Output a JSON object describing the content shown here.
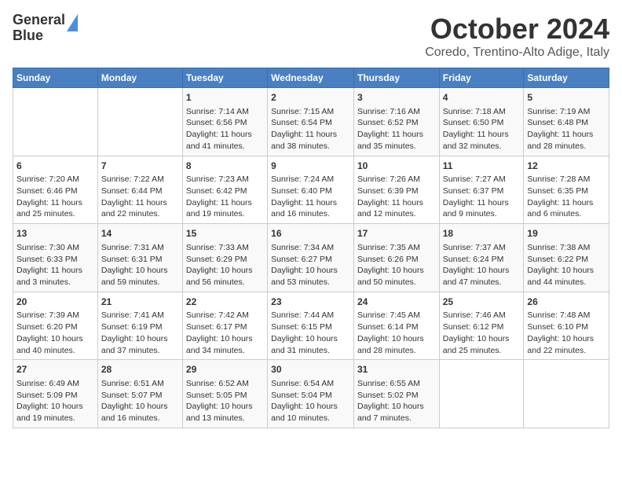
{
  "header": {
    "logo_line1": "General",
    "logo_line2": "Blue",
    "title": "October 2024",
    "subtitle": "Coredo, Trentino-Alto Adige, Italy"
  },
  "days_of_week": [
    "Sunday",
    "Monday",
    "Tuesday",
    "Wednesday",
    "Thursday",
    "Friday",
    "Saturday"
  ],
  "weeks": [
    [
      {
        "day": "",
        "content": ""
      },
      {
        "day": "",
        "content": ""
      },
      {
        "day": "1",
        "content": "Sunrise: 7:14 AM\nSunset: 6:56 PM\nDaylight: 11 hours and 41 minutes."
      },
      {
        "day": "2",
        "content": "Sunrise: 7:15 AM\nSunset: 6:54 PM\nDaylight: 11 hours and 38 minutes."
      },
      {
        "day": "3",
        "content": "Sunrise: 7:16 AM\nSunset: 6:52 PM\nDaylight: 11 hours and 35 minutes."
      },
      {
        "day": "4",
        "content": "Sunrise: 7:18 AM\nSunset: 6:50 PM\nDaylight: 11 hours and 32 minutes."
      },
      {
        "day": "5",
        "content": "Sunrise: 7:19 AM\nSunset: 6:48 PM\nDaylight: 11 hours and 28 minutes."
      }
    ],
    [
      {
        "day": "6",
        "content": "Sunrise: 7:20 AM\nSunset: 6:46 PM\nDaylight: 11 hours and 25 minutes."
      },
      {
        "day": "7",
        "content": "Sunrise: 7:22 AM\nSunset: 6:44 PM\nDaylight: 11 hours and 22 minutes."
      },
      {
        "day": "8",
        "content": "Sunrise: 7:23 AM\nSunset: 6:42 PM\nDaylight: 11 hours and 19 minutes."
      },
      {
        "day": "9",
        "content": "Sunrise: 7:24 AM\nSunset: 6:40 PM\nDaylight: 11 hours and 16 minutes."
      },
      {
        "day": "10",
        "content": "Sunrise: 7:26 AM\nSunset: 6:39 PM\nDaylight: 11 hours and 12 minutes."
      },
      {
        "day": "11",
        "content": "Sunrise: 7:27 AM\nSunset: 6:37 PM\nDaylight: 11 hours and 9 minutes."
      },
      {
        "day": "12",
        "content": "Sunrise: 7:28 AM\nSunset: 6:35 PM\nDaylight: 11 hours and 6 minutes."
      }
    ],
    [
      {
        "day": "13",
        "content": "Sunrise: 7:30 AM\nSunset: 6:33 PM\nDaylight: 11 hours and 3 minutes."
      },
      {
        "day": "14",
        "content": "Sunrise: 7:31 AM\nSunset: 6:31 PM\nDaylight: 10 hours and 59 minutes."
      },
      {
        "day": "15",
        "content": "Sunrise: 7:33 AM\nSunset: 6:29 PM\nDaylight: 10 hours and 56 minutes."
      },
      {
        "day": "16",
        "content": "Sunrise: 7:34 AM\nSunset: 6:27 PM\nDaylight: 10 hours and 53 minutes."
      },
      {
        "day": "17",
        "content": "Sunrise: 7:35 AM\nSunset: 6:26 PM\nDaylight: 10 hours and 50 minutes."
      },
      {
        "day": "18",
        "content": "Sunrise: 7:37 AM\nSunset: 6:24 PM\nDaylight: 10 hours and 47 minutes."
      },
      {
        "day": "19",
        "content": "Sunrise: 7:38 AM\nSunset: 6:22 PM\nDaylight: 10 hours and 44 minutes."
      }
    ],
    [
      {
        "day": "20",
        "content": "Sunrise: 7:39 AM\nSunset: 6:20 PM\nDaylight: 10 hours and 40 minutes."
      },
      {
        "day": "21",
        "content": "Sunrise: 7:41 AM\nSunset: 6:19 PM\nDaylight: 10 hours and 37 minutes."
      },
      {
        "day": "22",
        "content": "Sunrise: 7:42 AM\nSunset: 6:17 PM\nDaylight: 10 hours and 34 minutes."
      },
      {
        "day": "23",
        "content": "Sunrise: 7:44 AM\nSunset: 6:15 PM\nDaylight: 10 hours and 31 minutes."
      },
      {
        "day": "24",
        "content": "Sunrise: 7:45 AM\nSunset: 6:14 PM\nDaylight: 10 hours and 28 minutes."
      },
      {
        "day": "25",
        "content": "Sunrise: 7:46 AM\nSunset: 6:12 PM\nDaylight: 10 hours and 25 minutes."
      },
      {
        "day": "26",
        "content": "Sunrise: 7:48 AM\nSunset: 6:10 PM\nDaylight: 10 hours and 22 minutes."
      }
    ],
    [
      {
        "day": "27",
        "content": "Sunrise: 6:49 AM\nSunset: 5:09 PM\nDaylight: 10 hours and 19 minutes."
      },
      {
        "day": "28",
        "content": "Sunrise: 6:51 AM\nSunset: 5:07 PM\nDaylight: 10 hours and 16 minutes."
      },
      {
        "day": "29",
        "content": "Sunrise: 6:52 AM\nSunset: 5:05 PM\nDaylight: 10 hours and 13 minutes."
      },
      {
        "day": "30",
        "content": "Sunrise: 6:54 AM\nSunset: 5:04 PM\nDaylight: 10 hours and 10 minutes."
      },
      {
        "day": "31",
        "content": "Sunrise: 6:55 AM\nSunset: 5:02 PM\nDaylight: 10 hours and 7 minutes."
      },
      {
        "day": "",
        "content": ""
      },
      {
        "day": "",
        "content": ""
      }
    ]
  ]
}
